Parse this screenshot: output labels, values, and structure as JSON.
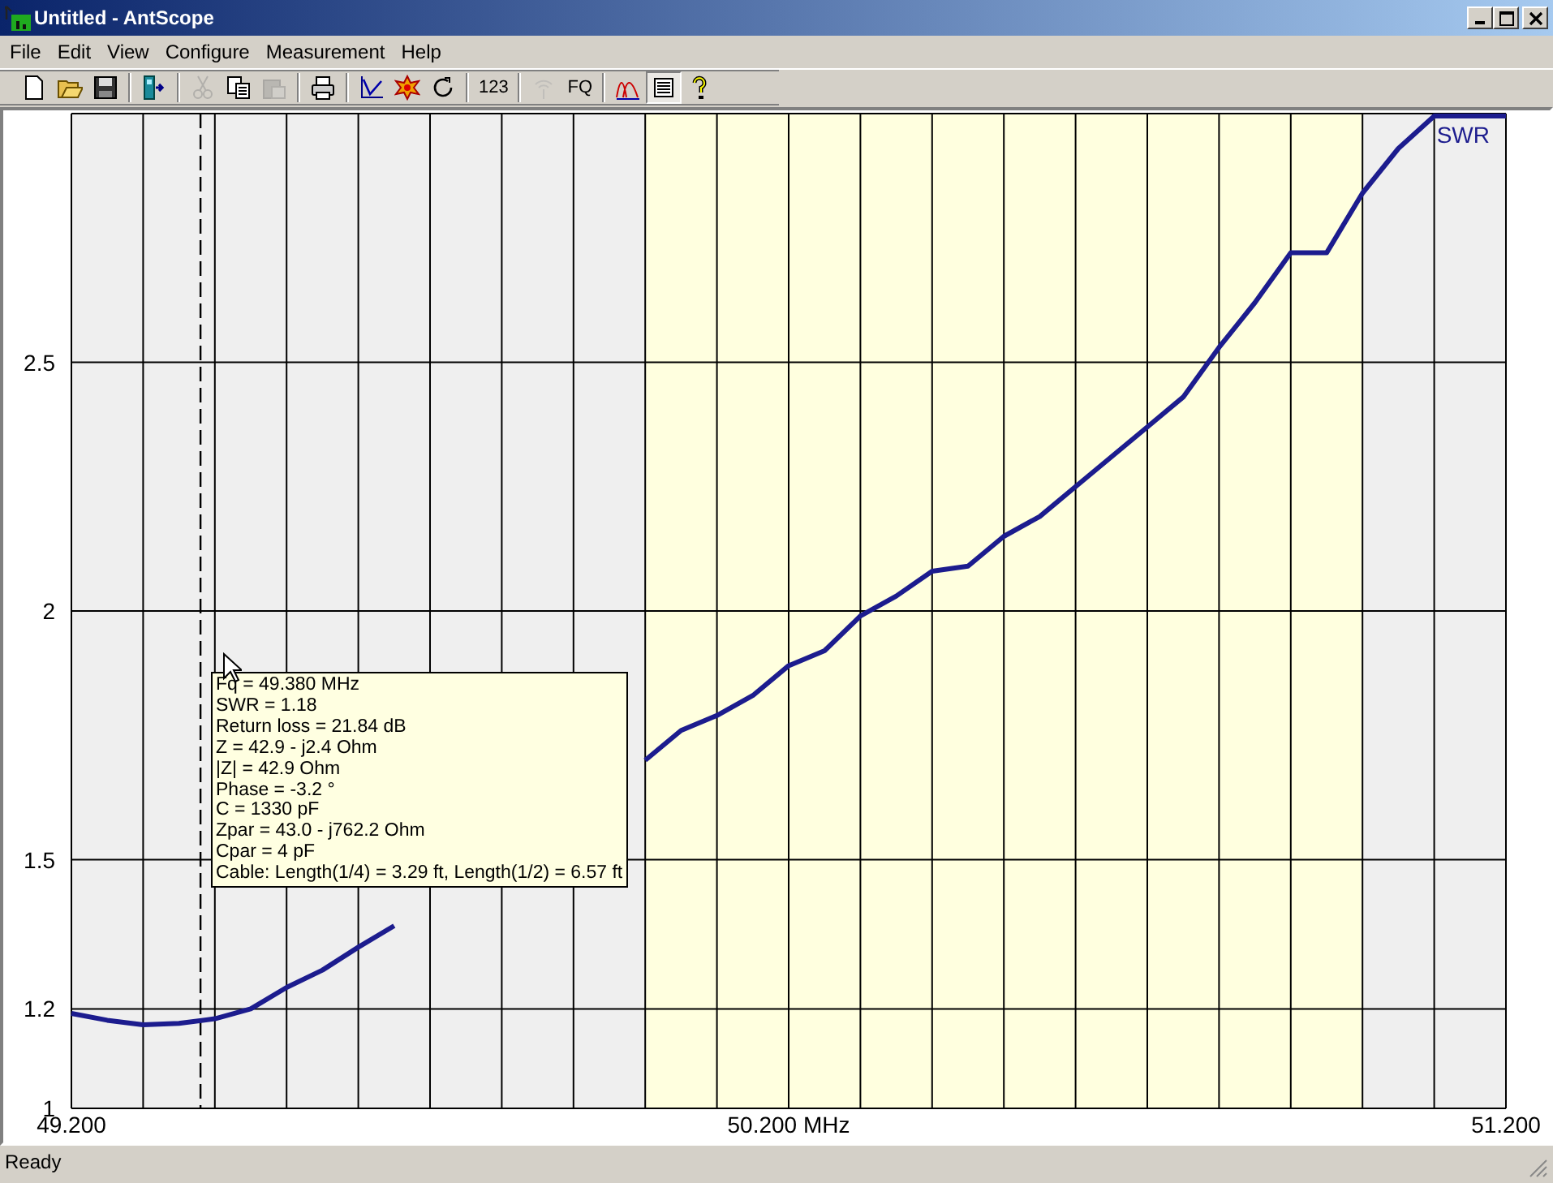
{
  "window": {
    "title": "Untitled - AntScope"
  },
  "menu": [
    {
      "label": "File"
    },
    {
      "label": "Edit"
    },
    {
      "label": "View"
    },
    {
      "label": "Configure"
    },
    {
      "label": "Measurement"
    },
    {
      "label": "Help"
    }
  ],
  "toolbar": [
    {
      "kind": "icon",
      "disabled": false,
      "pressed": false
    },
    {
      "kind": "icon",
      "disabled": false,
      "pressed": false
    },
    {
      "kind": "icon",
      "disabled": false,
      "pressed": false
    },
    {
      "kind": "separator"
    },
    {
      "kind": "icon",
      "disabled": false,
      "pressed": false
    },
    {
      "kind": "separator"
    },
    {
      "kind": "icon",
      "disabled": true,
      "pressed": false
    },
    {
      "kind": "icon",
      "disabled": false,
      "pressed": false
    },
    {
      "kind": "icon",
      "disabled": true,
      "pressed": false
    },
    {
      "kind": "separator"
    },
    {
      "kind": "icon",
      "disabled": false,
      "pressed": false
    },
    {
      "kind": "separator"
    },
    {
      "kind": "icon",
      "disabled": false,
      "pressed": false
    },
    {
      "kind": "icon",
      "disabled": false,
      "pressed": false
    },
    {
      "kind": "icon",
      "disabled": false,
      "pressed": false
    },
    {
      "kind": "separator"
    },
    {
      "kind": "text",
      "label": "123",
      "disabled": false,
      "pressed": false
    },
    {
      "kind": "separator"
    },
    {
      "kind": "icon",
      "disabled": true,
      "pressed": false
    },
    {
      "kind": "text",
      "label": "FQ",
      "disabled": false,
      "pressed": false
    },
    {
      "kind": "separator"
    },
    {
      "kind": "icon",
      "disabled": false,
      "pressed": false
    },
    {
      "kind": "icon",
      "disabled": false,
      "pressed": true
    },
    {
      "kind": "icon",
      "disabled": false,
      "pressed": false
    }
  ],
  "chart": {
    "chart_data": {
      "type": "line",
      "grid": true,
      "x": [
        49.2,
        49.25,
        49.3,
        49.35,
        49.4,
        49.45,
        49.5,
        49.55,
        49.6,
        49.65,
        49.7,
        49.75,
        49.8,
        49.85,
        49.9,
        49.95,
        50.0,
        50.05,
        50.1,
        50.15,
        50.2,
        50.25,
        50.3,
        50.35,
        50.4,
        50.45,
        50.5,
        50.55,
        50.6,
        50.65,
        50.7,
        50.75,
        50.8,
        50.85,
        50.9,
        50.95,
        51.0,
        51.05,
        51.1,
        51.15,
        51.2
      ],
      "series": [
        {
          "name": "SWR",
          "color": "#1c1c8e",
          "values": [
            1.191,
            1.177,
            1.168,
            1.171,
            1.18,
            1.2,
            1.243,
            1.278,
            1.324,
            1.367,
            null,
            null,
            null,
            null,
            null,
            null,
            1.7,
            1.76,
            1.79,
            1.83,
            1.89,
            1.92,
            1.99,
            2.03,
            2.08,
            2.09,
            2.15,
            2.19,
            2.25,
            2.31,
            2.37,
            2.43,
            2.53,
            2.62,
            2.72,
            2.72,
            2.84,
            2.93,
            2.995,
            2.995,
            2.995
          ]
        }
      ],
      "xlim": [
        49.2,
        51.2
      ],
      "ylim": [
        1,
        3
      ],
      "xticks": [
        {
          "value": 49.2,
          "label": "49.200"
        },
        {
          "value": 50.2,
          "label": "50.200 MHz"
        },
        {
          "value": 51.2,
          "label": "51.200"
        }
      ],
      "yticks": [
        1,
        1.2,
        1.5,
        2,
        2.5
      ],
      "bands": [
        {
          "axis": "x",
          "from": 50.0,
          "to": 51.0
        }
      ],
      "ref_lines": [
        {
          "axis": "x",
          "value": 49.38
        }
      ]
    },
    "tooltip": [
      "Fq = 49.380 MHz",
      "SWR = 1.18",
      "Return loss = 21.84 dB",
      "Z = 42.9 - j2.4 Ohm",
      "|Z| = 42.9 Ohm",
      "Phase = -3.2 °",
      "C = 1330 pF",
      "Zpar = 43.0 - j762.2 Ohm",
      "Cpar = 4 pF",
      "Cable: Length(1/4) = 3.29 ft, Length(1/2) = 6.57 ft"
    ]
  },
  "status_bar": {
    "text": "Ready"
  }
}
